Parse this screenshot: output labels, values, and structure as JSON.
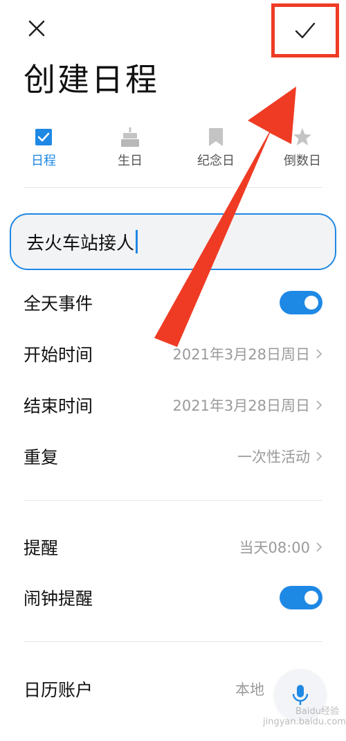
{
  "title": "创建日程",
  "tabs": [
    {
      "label": "日程",
      "icon": "checkbox-icon",
      "active": true
    },
    {
      "label": "生日",
      "icon": "cake-icon",
      "active": false
    },
    {
      "label": "纪念日",
      "icon": "bookmark-icon",
      "active": false
    },
    {
      "label": "倒数日",
      "icon": "star-icon",
      "active": false
    }
  ],
  "event_title": "去火车站接人",
  "rows": {
    "all_day": {
      "label": "全天事件",
      "on": true
    },
    "start": {
      "label": "开始时间",
      "value": "2021年3月28日周日"
    },
    "end": {
      "label": "结束时间",
      "value": "2021年3月28日周日"
    },
    "repeat": {
      "label": "重复",
      "value": "一次性活动"
    },
    "reminder": {
      "label": "提醒",
      "value": "当天08:00"
    },
    "alarm": {
      "label": "闹钟提醒",
      "on": true
    },
    "account": {
      "label": "日历账户",
      "value": "本地"
    }
  },
  "watermark": {
    "line1": "Baidu经验",
    "line2": "jingyan.baidu.com"
  },
  "colors": {
    "accent": "#1e88e5",
    "annotation": "#ef3b24"
  }
}
